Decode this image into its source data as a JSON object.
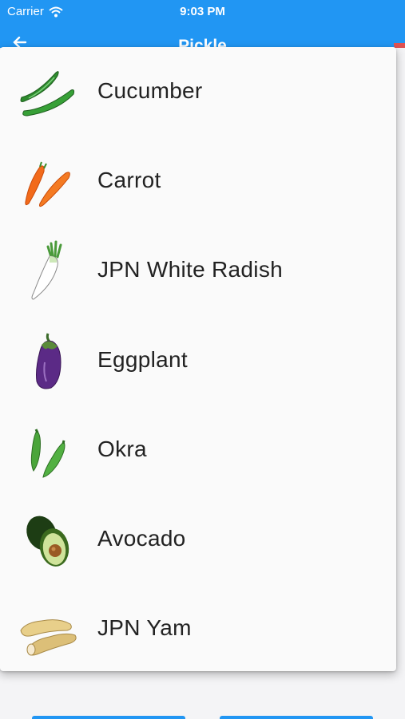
{
  "status_bar": {
    "carrier": "Carrier",
    "time": "9:03 PM"
  },
  "app_bar": {
    "title": "Pickle"
  },
  "list": {
    "items": [
      {
        "label": "Cucumber",
        "icon": "cucumber-icon"
      },
      {
        "label": "Carrot",
        "icon": "carrot-icon"
      },
      {
        "label": "JPN White Radish",
        "icon": "radish-icon"
      },
      {
        "label": "Eggplant",
        "icon": "eggplant-icon"
      },
      {
        "label": "Okra",
        "icon": "okra-icon"
      },
      {
        "label": "Avocado",
        "icon": "avocado-icon"
      },
      {
        "label": "JPN Yam",
        "icon": "yam-icon"
      }
    ]
  },
  "colors": {
    "accent": "#2196f3",
    "sheet": "#fafafa",
    "text": "#222222"
  }
}
